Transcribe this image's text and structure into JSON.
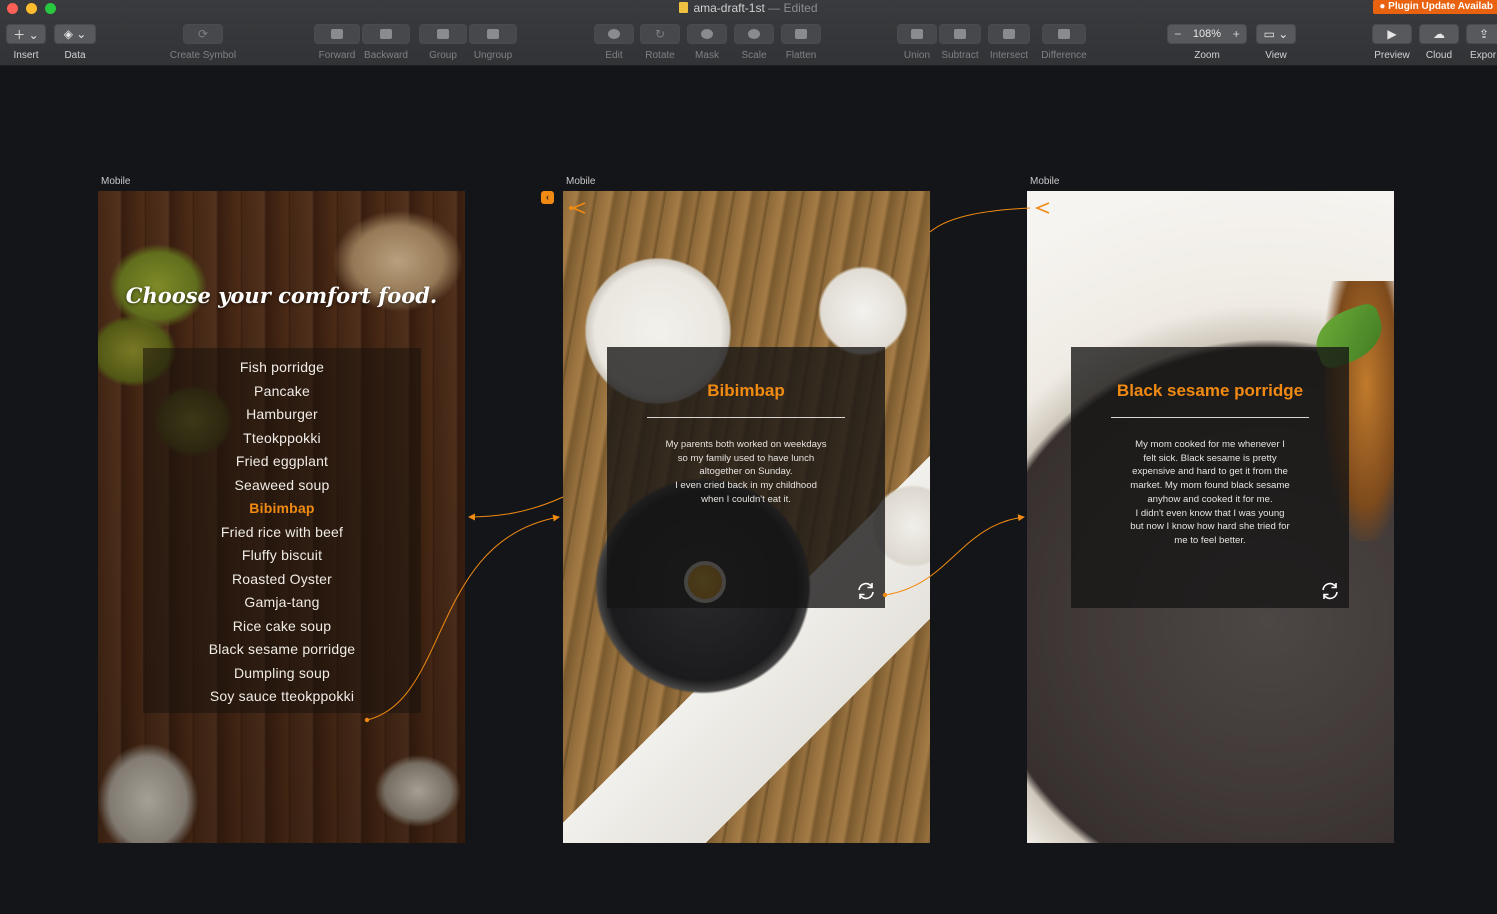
{
  "window": {
    "document_name": "ama-draft-1st",
    "separator": "—",
    "status": "Edited",
    "plugin_badge": "Plugin Update Availab"
  },
  "toolbar": {
    "insert": {
      "label": "Insert",
      "icon": "plus-icon"
    },
    "data": {
      "label": "Data",
      "icon": "layers-icon"
    },
    "create_symbol": {
      "label": "Create Symbol",
      "icon": "symbol-icon"
    },
    "forward": {
      "label": "Forward"
    },
    "backward": {
      "label": "Backward"
    },
    "group": {
      "label": "Group"
    },
    "ungroup": {
      "label": "Ungroup"
    },
    "edit": {
      "label": "Edit"
    },
    "rotate": {
      "label": "Rotate"
    },
    "mask": {
      "label": "Mask"
    },
    "scale": {
      "label": "Scale"
    },
    "flatten": {
      "label": "Flatten"
    },
    "union": {
      "label": "Union"
    },
    "subtract": {
      "label": "Subtract"
    },
    "intersect": {
      "label": "Intersect"
    },
    "difference": {
      "label": "Difference"
    },
    "zoom": {
      "label": "Zoom",
      "value": "108%",
      "minus": "−",
      "plus": "+"
    },
    "view": {
      "label": "View"
    },
    "preview": {
      "label": "Preview"
    },
    "cloud": {
      "label": "Cloud"
    },
    "export": {
      "label": "Expor"
    }
  },
  "artboards": [
    {
      "label": "Mobile",
      "title": "Choose your comfort food.",
      "menu": [
        "Fish porridge",
        "Pancake",
        "Hamburger",
        "Tteokppokki",
        "Fried eggplant",
        "Seaweed soup",
        "Bibimbap",
        "Fried rice with beef",
        "Fluffy biscuit",
        "Roasted Oyster",
        "Gamja-tang",
        "Rice cake soup",
        "Black sesame porridge",
        "Dumpling soup",
        "Soy sauce tteokppokki"
      ],
      "active_item": "Bibimbap"
    },
    {
      "label": "Mobile",
      "title": "Bibimbap",
      "body": [
        "My parents both worked on weekdays",
        "so my family used to have lunch",
        "altogether on Sunday.",
        "I even cried back in my childhood",
        "when I couldn't eat it."
      ]
    },
    {
      "label": "Mobile",
      "title": "Black sesame porridge",
      "body": [
        "My mom cooked for me whenever I",
        "felt sick. Black sesame is pretty",
        "expensive and hard to get it from the",
        "market. My mom found black sesame",
        "anyhow and cooked it for me.",
        "I didn't even know that I was young",
        "but now I know how hard she tried for",
        "me to feel better."
      ]
    }
  ],
  "colors": {
    "accent": "#f08a12",
    "canvas": "#141518",
    "toolbar": "#353639"
  }
}
